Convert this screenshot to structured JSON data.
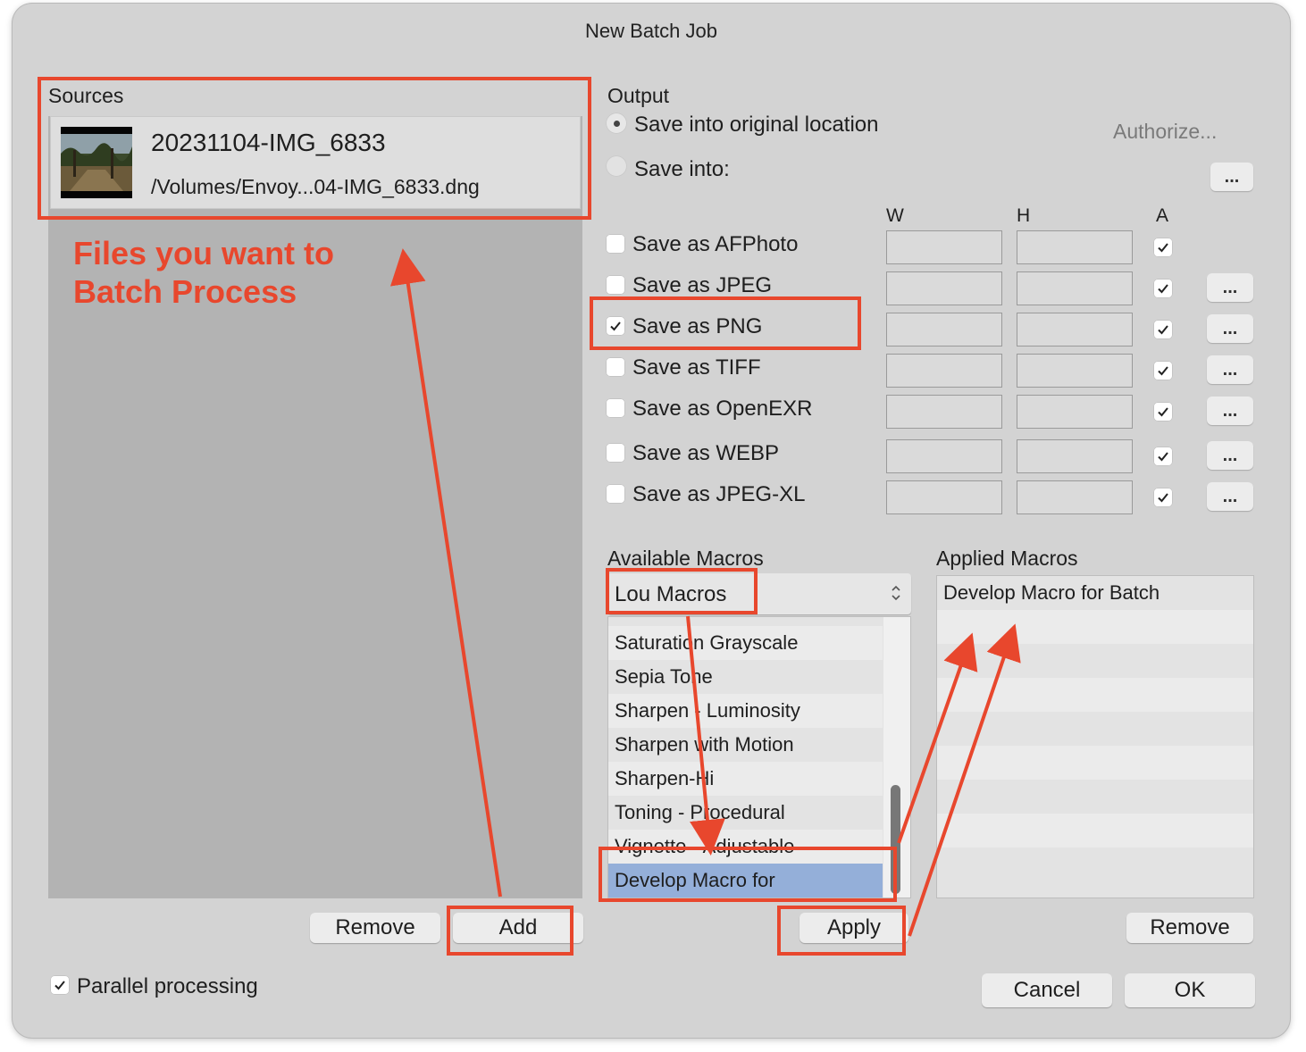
{
  "window": {
    "title": "New Batch Job"
  },
  "sources": {
    "label": "Sources",
    "items": [
      {
        "name": "20231104-IMG_6833",
        "path": "/Volumes/Envoy...04-IMG_6833.dng"
      }
    ],
    "remove_label": "Remove",
    "add_label": "Add"
  },
  "annotation": {
    "line1": "Files you want to",
    "line2": "Batch Process"
  },
  "output": {
    "label": "Output",
    "save_original_label": "Save into original location",
    "save_into_label": "Save into:",
    "save_original_selected": true,
    "authorize_label": "Authorize...",
    "browse_label": "...",
    "col_w": "W",
    "col_h": "H",
    "col_a": "A",
    "formats": [
      {
        "label": "Save as AFPhoto",
        "checked": false,
        "a_checked": true,
        "has_options": false,
        "options_label": "..."
      },
      {
        "label": "Save as JPEG",
        "checked": false,
        "a_checked": true,
        "has_options": true,
        "options_label": "..."
      },
      {
        "label": "Save as PNG",
        "checked": true,
        "a_checked": true,
        "has_options": true,
        "options_label": "..."
      },
      {
        "label": "Save as TIFF",
        "checked": false,
        "a_checked": true,
        "has_options": true,
        "options_label": "..."
      },
      {
        "label": "Save as OpenEXR",
        "checked": false,
        "a_checked": true,
        "has_options": true,
        "options_label": "..."
      },
      {
        "label": "Save as WEBP",
        "checked": false,
        "a_checked": true,
        "has_options": true,
        "options_label": "..."
      },
      {
        "label": "Save as JPEG-XL",
        "checked": false,
        "a_checked": true,
        "has_options": true,
        "options_label": "..."
      }
    ]
  },
  "macros": {
    "available_label": "Available Macros",
    "category_selected": "Lou Macros",
    "available_items": [
      "Saturation Grayscale",
      "Sepia Tone",
      "Sharpen - Luminosity",
      "Sharpen with Motion",
      "Sharpen-Hi",
      "Toning - Procedural",
      "Vignette - Adjustable",
      "Develop Macro for"
    ],
    "available_selected_index": 7,
    "applied_label": "Applied Macros",
    "applied_items": [
      "Develop Macro for Batch"
    ],
    "apply_label": "Apply",
    "remove_label": "Remove"
  },
  "footer": {
    "parallel_label": "Parallel processing",
    "parallel_checked": true,
    "cancel_label": "Cancel",
    "ok_label": "OK"
  },
  "colors": {
    "annotation_red": "#e8472d",
    "selection_blue": "#94afd9",
    "dialog_bg": "#d3d3d3"
  }
}
